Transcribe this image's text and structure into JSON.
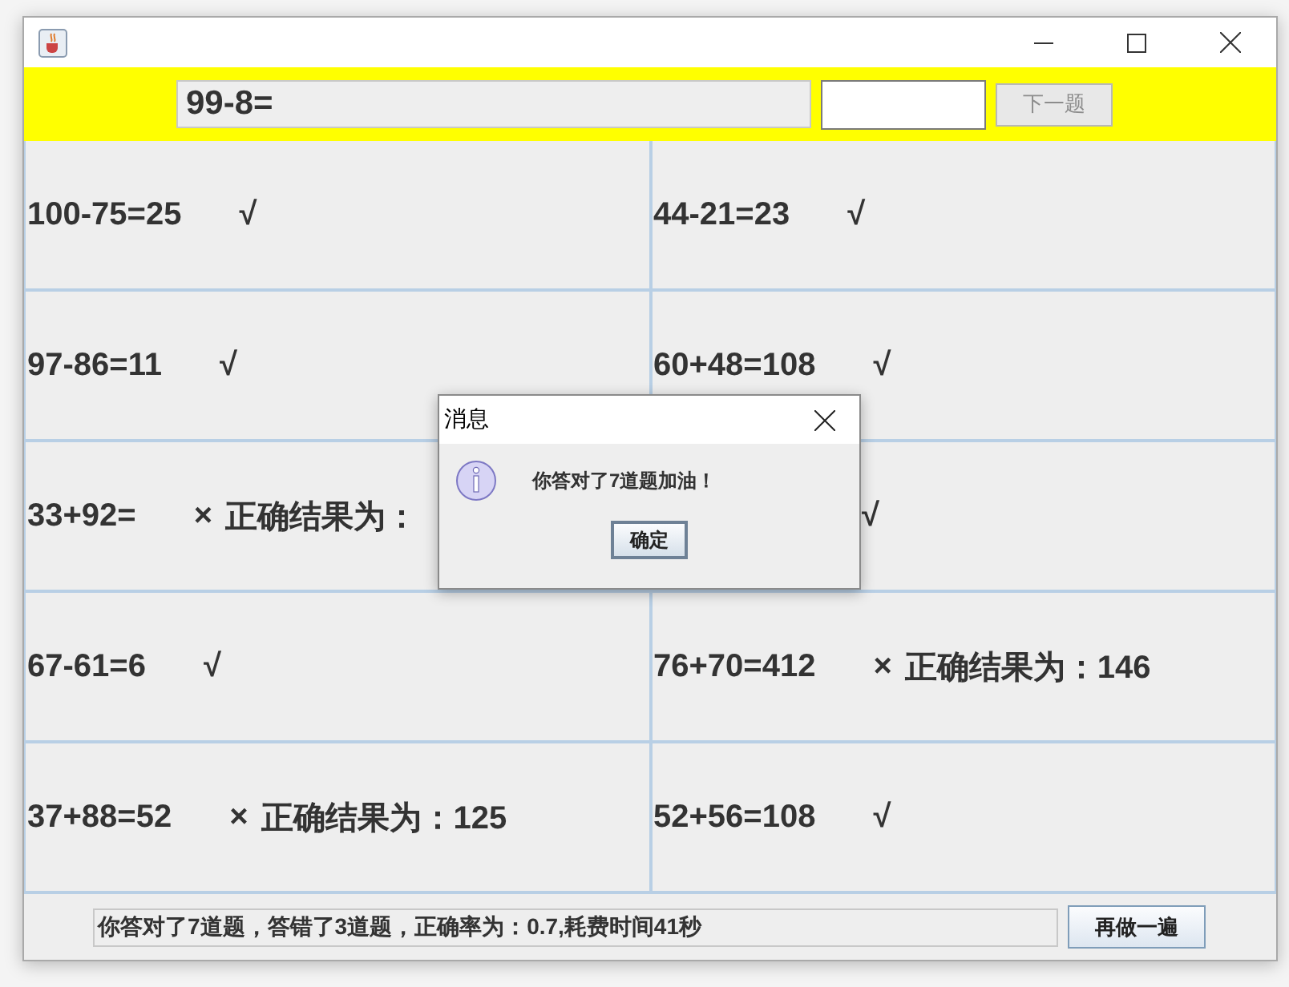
{
  "question": {
    "expression": "99-8=",
    "next_button": {
      "label": "下一题",
      "disabled": true
    }
  },
  "cells": [
    {
      "expression": "100-75=25",
      "kind": "correct",
      "mark": "√"
    },
    {
      "expression": "44-21=23",
      "kind": "correct",
      "mark": "√"
    },
    {
      "expression": "97-86=11",
      "kind": "correct",
      "mark": "√"
    },
    {
      "expression": "60+48=108",
      "kind": "correct",
      "mark": "√"
    },
    {
      "expression": "33+92=",
      "kind": "wrong",
      "mark": "×",
      "note": "正确结果为："
    },
    {
      "kind": "correct",
      "mark": "√"
    },
    {
      "expression": "67-61=6",
      "kind": "correct",
      "mark": "√"
    },
    {
      "expression": "76+70=412",
      "kind": "wrong",
      "mark": "×",
      "note": "正确结果为：146"
    },
    {
      "expression": "37+88=52",
      "kind": "wrong",
      "mark": "×",
      "note": "正确结果为：125"
    },
    {
      "expression": "52+56=108",
      "kind": "correct",
      "mark": "√"
    }
  ],
  "summary": {
    "text": "你答对了7道题，答错了3道题，正确率为：0.7,耗费时间41秒",
    "button": "再做一遍"
  },
  "dialog": {
    "title": "消息",
    "message": "你答对了7道题加油！",
    "button": "确定"
  }
}
